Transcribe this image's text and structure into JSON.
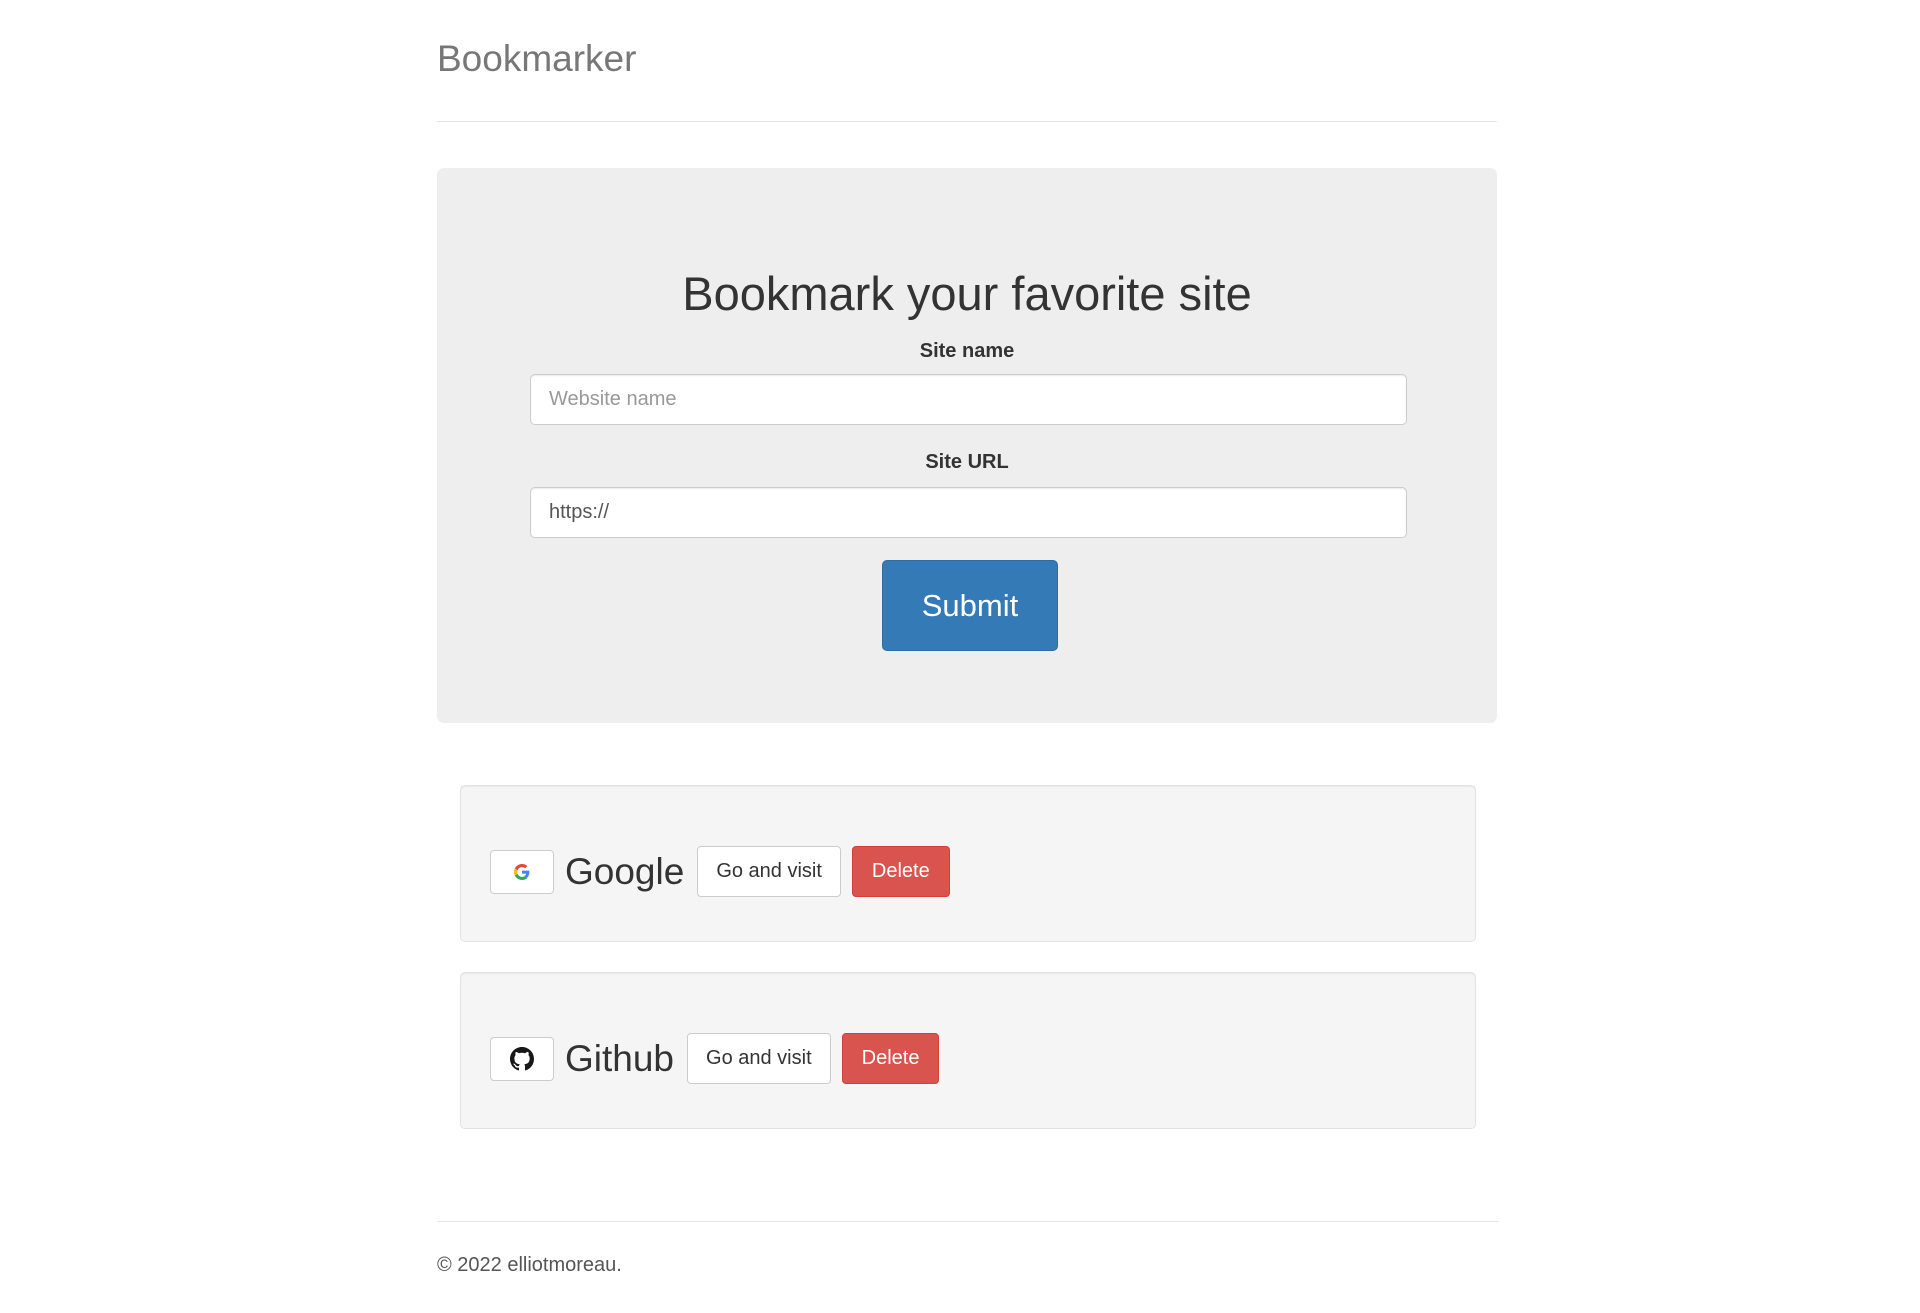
{
  "header": {
    "brand": "Bookmarker"
  },
  "form": {
    "title": "Bookmark your favorite site",
    "site_name_label": "Site name",
    "site_name_placeholder": "Website name",
    "site_url_label": "Site URL",
    "site_url_value": "https://",
    "submit_label": "Submit"
  },
  "bookmarks": [
    {
      "name": "Google",
      "icon": "google-g-icon",
      "visit_label": "Go and visit",
      "delete_label": "Delete"
    },
    {
      "name": "Github",
      "icon": "github-icon",
      "visit_label": "Go and visit",
      "delete_label": "Delete"
    }
  ],
  "footer": {
    "text": "© 2022 elliotmoreau."
  },
  "colors": {
    "primary": "#337ab7",
    "danger": "#d9534f",
    "jumbotron_bg": "#eeeeee",
    "card_bg": "#f5f5f5"
  }
}
